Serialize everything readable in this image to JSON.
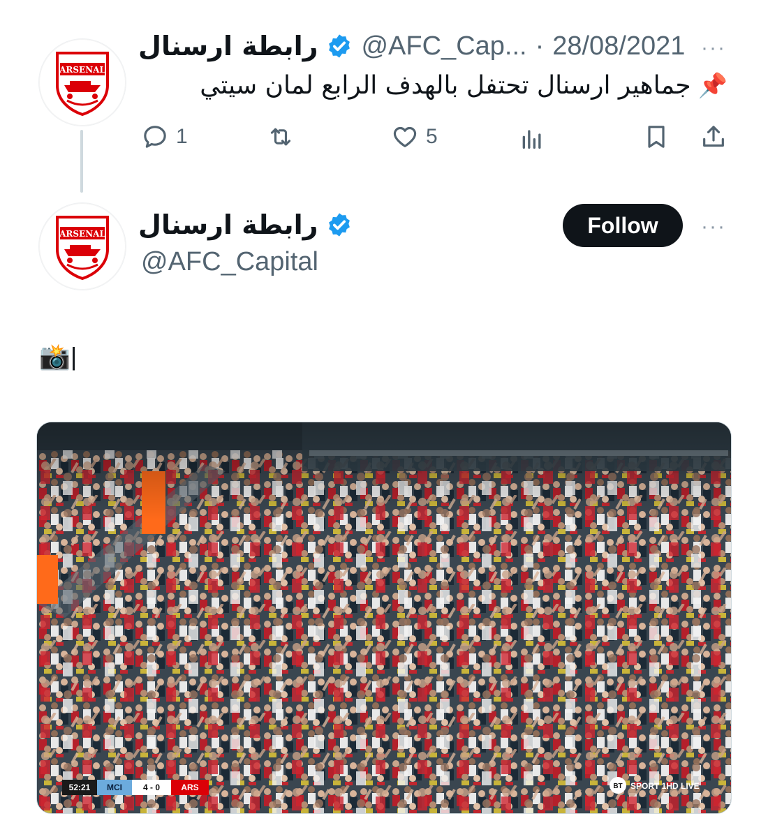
{
  "quoted_tweet": {
    "display_name": "رابطة ارسنال",
    "handle": "@AFC_Cap...",
    "separator": "·",
    "date": "28/08/2021",
    "text": "جماهير ارسنال تحتفل بالهدف الرابع لمان سيتي",
    "pin_emoji": "📌",
    "more_label": "···",
    "actions": {
      "reply_count": "1",
      "like_count": "5"
    },
    "avatar_text": "ARSENAL"
  },
  "main_tweet": {
    "display_name": "رابطة ارسنال",
    "handle": "@AFC_Capital",
    "follow_label": "Follow",
    "more_label": "···",
    "text": "📸|",
    "avatar_text": "ARSENAL"
  },
  "media": {
    "scorebug": {
      "clock": "52:21",
      "home": "MCI",
      "score": "4 - 0",
      "away": "ARS"
    },
    "broadcaster": "SPORT 1HD LIVE",
    "broadcaster_badge": "BT"
  },
  "colors": {
    "verified": "#1d9bf0",
    "arsenal_red": "#db0007",
    "text_primary": "#0f1419",
    "text_secondary": "#536471"
  }
}
